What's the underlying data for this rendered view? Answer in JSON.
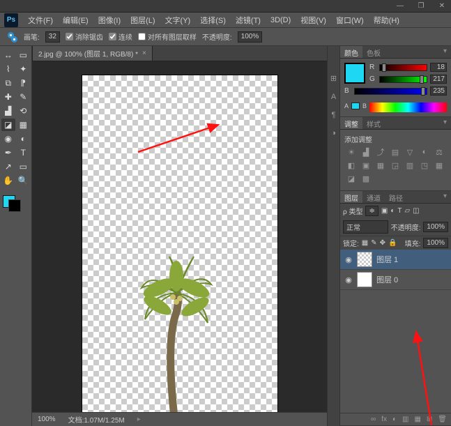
{
  "window": {
    "minimize": "—",
    "restore": "❐",
    "close": "✕"
  },
  "menu": [
    "文件(F)",
    "编辑(E)",
    "图像(I)",
    "图层(L)",
    "文字(Y)",
    "选择(S)",
    "滤镜(T)",
    "3D(D)",
    "视图(V)",
    "窗口(W)",
    "帮助(H)"
  ],
  "options": {
    "brush_label": "画笔:",
    "brush_size": "32",
    "chk_antialias": "消除锯齿",
    "chk_contiguous": "连续",
    "chk_all_layers": "对所有图层取样",
    "opacity_label": "不透明度:",
    "opacity": "100%"
  },
  "doc": {
    "tab": "2.jpg @ 100% (图层 1, RGB/8) *",
    "close": "×",
    "zoom": "100%",
    "filesize": "文档:1.07M/1.25M"
  },
  "color_panel": {
    "tabs": [
      "颜色",
      "色板"
    ],
    "r_label": "R",
    "r_val": "18",
    "g_label": "G",
    "g_val": "217",
    "b_label": "B",
    "b_val": "235"
  },
  "adjust_panel": {
    "tabs": [
      "调整",
      "样式"
    ],
    "title": "添加调整"
  },
  "layers_panel": {
    "tabs": [
      "图层",
      "通道",
      "路径"
    ],
    "kind_label": "ρ 类型",
    "blend": "正常",
    "opacity_label": "不透明度:",
    "opacity": "100%",
    "lock_label": "锁定:",
    "fill_label": "填充:",
    "fill": "100%",
    "items": [
      {
        "name": "图层 1",
        "selected": true
      },
      {
        "name": "图层 0",
        "selected": false
      }
    ]
  },
  "footer_icons": [
    "∞",
    "fx",
    "◐",
    "▥",
    "▦",
    "⊞",
    "🗑"
  ]
}
